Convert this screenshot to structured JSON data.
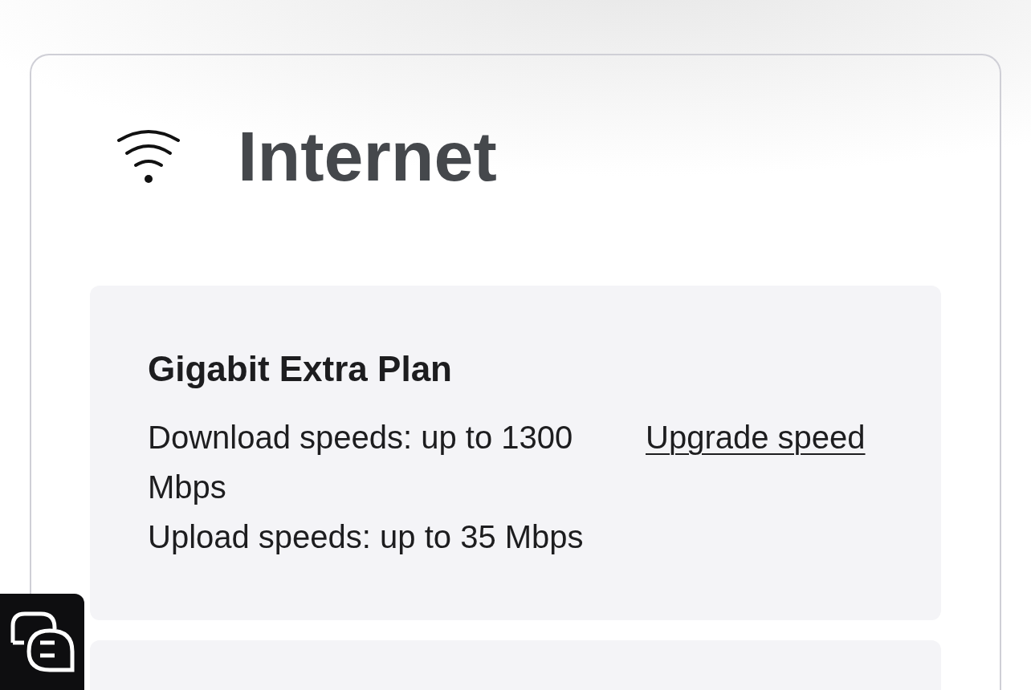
{
  "section": {
    "title": "Internet"
  },
  "plan": {
    "name": "Gigabit Extra Plan",
    "download": "Download speeds: up to 1300 Mbps",
    "upload": "Upload speeds: up to 35 Mbps",
    "link": "Upgrade speed"
  }
}
